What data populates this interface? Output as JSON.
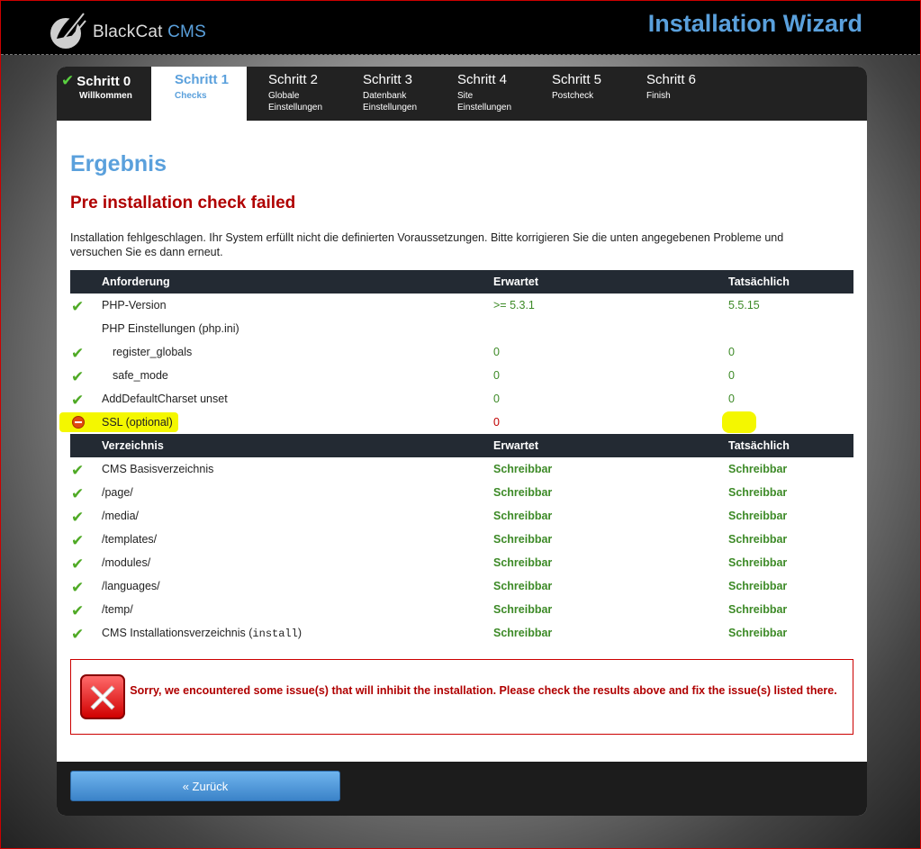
{
  "header": {
    "logo_brand": "BlackCat",
    "logo_suffix": "CMS",
    "wizard_title": "Installation Wizard"
  },
  "tabs": [
    {
      "label": "Schritt 0",
      "sub1": "Willkommen",
      "sub2": "",
      "state": "done"
    },
    {
      "label": "Schritt 1",
      "sub1": "Checks",
      "sub2": "",
      "state": "active"
    },
    {
      "label": "Schritt 2",
      "sub1": "Globale",
      "sub2": "Einstellungen",
      "state": "todo"
    },
    {
      "label": "Schritt 3",
      "sub1": "Datenbank",
      "sub2": "Einstellungen",
      "state": "todo"
    },
    {
      "label": "Schritt 4",
      "sub1": "Site",
      "sub2": "Einstellungen",
      "state": "todo"
    },
    {
      "label": "Schritt 5",
      "sub1": "Postcheck",
      "sub2": "",
      "state": "todo"
    },
    {
      "label": "Schritt 6",
      "sub1": "Finish",
      "sub2": "",
      "state": "todo"
    }
  ],
  "content": {
    "heading": "Ergebnis",
    "status_heading": "Pre installation check failed",
    "intro": "Installation fehlgeschlagen. Ihr System erfüllt nicht die definierten Voraussetzungen. Bitte korrigieren Sie die unten angegebenen Probleme und versuchen Sie es dann erneut."
  },
  "requirements": {
    "headers": {
      "col1": "Anforderung",
      "col2": "Erwartet",
      "col3": "Tatsächlich"
    },
    "rows": [
      {
        "label": "PHP-Version",
        "expected": ">= 5.3.1",
        "actual": "5.5.15"
      },
      {
        "label": "PHP Einstellungen (php.ini)",
        "expected": "",
        "actual": ""
      },
      {
        "label": "register_globals",
        "expected": "0",
        "actual": "0"
      },
      {
        "label": "safe_mode",
        "expected": "0",
        "actual": "0"
      },
      {
        "label": "AddDefaultCharset unset",
        "expected": "0",
        "actual": "0"
      },
      {
        "label": "SSL (optional)",
        "expected": "0",
        "actual": ""
      }
    ]
  },
  "directories": {
    "headers": {
      "col1": "Verzeichnis",
      "col2": "Erwartet",
      "col3": "Tatsächlich"
    },
    "rows": [
      {
        "label": "CMS Basisverzeichnis",
        "expected": "Schreibbar",
        "actual": "Schreibbar"
      },
      {
        "label": "/page/",
        "expected": "Schreibbar",
        "actual": "Schreibbar"
      },
      {
        "label": "/media/",
        "expected": "Schreibbar",
        "actual": "Schreibbar"
      },
      {
        "label": "/templates/",
        "expected": "Schreibbar",
        "actual": "Schreibbar"
      },
      {
        "label": "/modules/",
        "expected": "Schreibbar",
        "actual": "Schreibbar"
      },
      {
        "label": "/languages/",
        "expected": "Schreibbar",
        "actual": "Schreibbar"
      },
      {
        "label": "/temp/",
        "expected": "Schreibbar",
        "actual": "Schreibbar"
      },
      {
        "label_prefix": "CMS Installationsverzeichnis (",
        "label_code": "install",
        "label_suffix": ")",
        "expected": "Schreibbar",
        "actual": "Schreibbar"
      }
    ]
  },
  "error": {
    "message": "Sorry, we encountered some issue(s) that will inhibit the installation. Please check the results above and fix the issue(s) listed there."
  },
  "footer": {
    "back_label": "« Zurück"
  },
  "colors": {
    "accent": "#5aa0dc",
    "error": "#b00000",
    "ok": "#3d8a27",
    "highlight": "#f4f700"
  }
}
